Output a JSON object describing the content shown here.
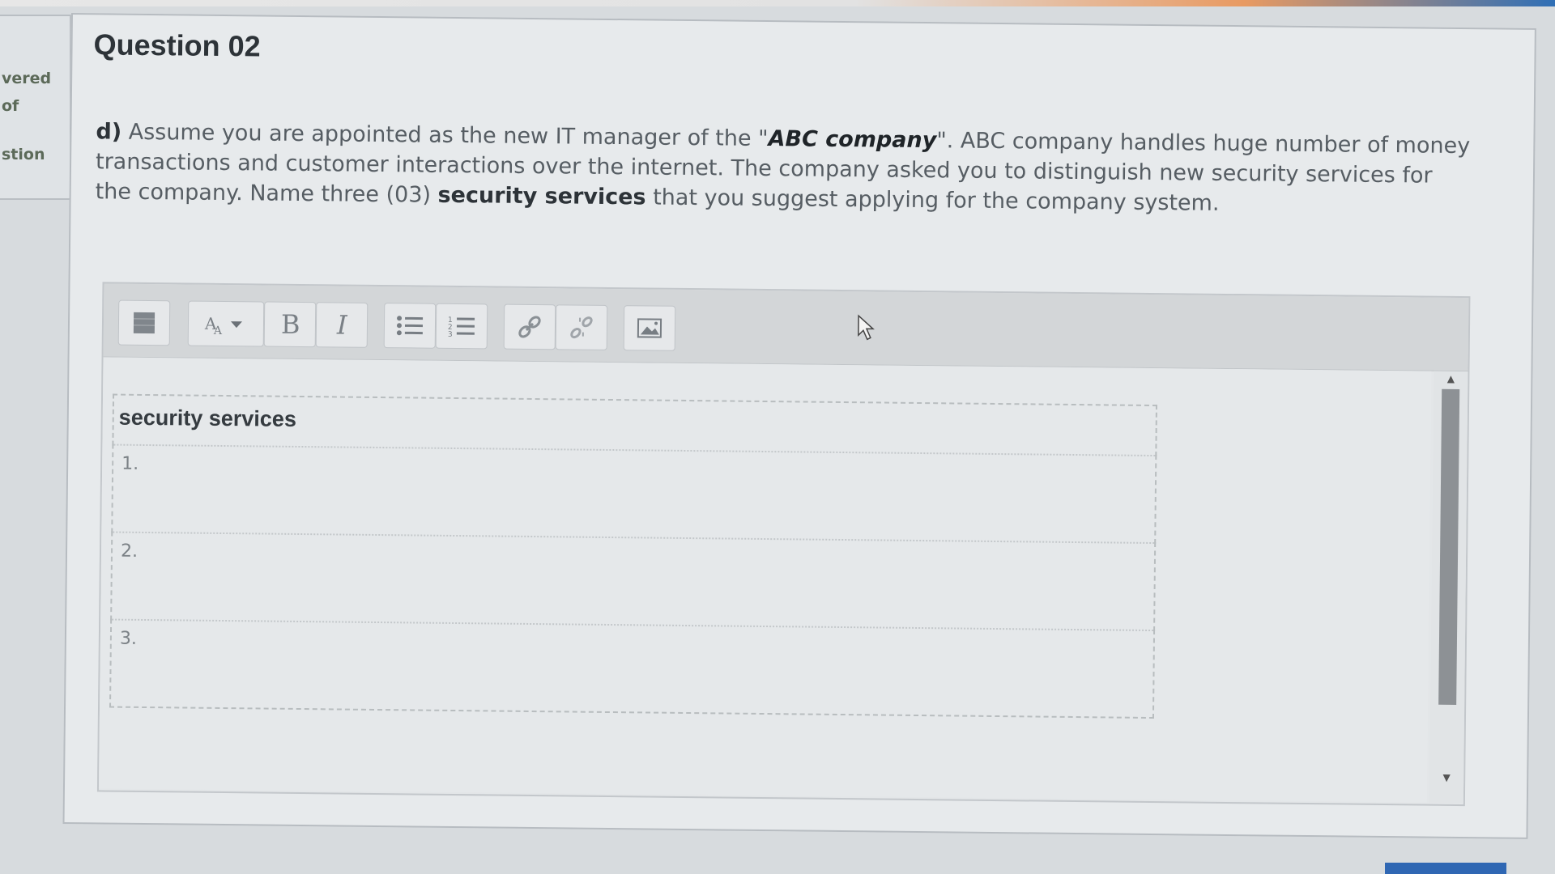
{
  "sidebar": {
    "lines": [
      "vered",
      "of",
      "stion"
    ]
  },
  "question": {
    "title": "Question 02",
    "part": "d)",
    "text_before": " Assume you are appointed as the new IT manager of the \"",
    "company_name": "ABC company",
    "text_after": "\". ABC company handles huge number of money transactions and customer interactions over the internet. The company asked you to distinguish new security services for the company. Name three (03) ",
    "bold_phrase": "security services",
    "text_end": " that you suggest applying for the company system."
  },
  "editor": {
    "toolbar_icons": [
      "show-more-icon",
      "font-size-icon",
      "bold-icon",
      "italic-icon",
      "bullet-list-icon",
      "numbered-list-icon",
      "link-icon",
      "unlink-icon",
      "image-icon"
    ],
    "table": {
      "header": "security services",
      "rows": [
        "1.",
        "2.",
        "3."
      ]
    }
  },
  "colors": {
    "accent": "#2f67b3",
    "title": "#2d3338"
  }
}
